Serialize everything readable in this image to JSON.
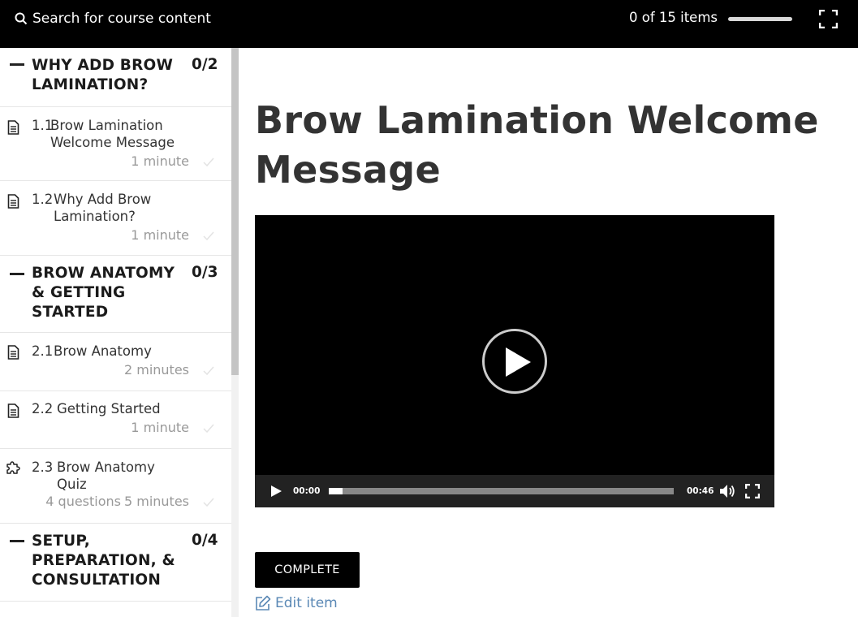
{
  "header": {
    "search_label": "Search for course content",
    "progress_text": "0 of 15 items",
    "progress_fraction": 0
  },
  "sidebar": {
    "sections": [
      {
        "title": "WHY ADD BROW LAMINATION?",
        "count": "0/2",
        "items": [
          {
            "num": "1.1",
            "title": "Brow Lamination Welcome Message",
            "meta": "1 minute",
            "icon": "document-icon"
          },
          {
            "num": "1.2",
            "title": "Why Add Brow Lamination?",
            "meta": "1 minute",
            "icon": "document-icon"
          }
        ]
      },
      {
        "title": "BROW ANATOMY & GETTING STARTED",
        "count": "0/3",
        "items": [
          {
            "num": "2.1",
            "title": "Brow Anatomy",
            "meta": "2 minutes",
            "icon": "document-icon"
          },
          {
            "num": "2.2",
            "title": "Getting Started",
            "meta": "1 minute",
            "icon": "document-icon"
          },
          {
            "num": "2.3",
            "title": "Brow Anatomy Quiz",
            "meta_questions": "4 questions",
            "meta": "5 minutes",
            "icon": "puzzle-icon"
          }
        ]
      },
      {
        "title": "SETUP, PREPARATION, & CONSULTATION",
        "count": "0/4",
        "items": []
      }
    ]
  },
  "main": {
    "title": "Brow Lamination Welcome Message",
    "video": {
      "current_time": "00:00",
      "duration": "00:46",
      "played_fraction": 0.04
    },
    "complete_label": "COMPLETE",
    "edit_label": "Edit item"
  }
}
